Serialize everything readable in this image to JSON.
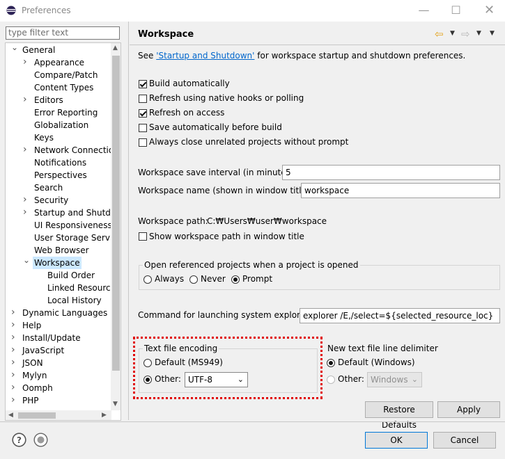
{
  "window": {
    "title": "Preferences",
    "minimize_icon": "minimize-icon",
    "maximize_icon": "maximize-icon",
    "close_icon": "close-icon"
  },
  "filter": {
    "placeholder": "type filter text"
  },
  "tree": [
    {
      "label": "General",
      "depth": 0,
      "arrow": "expanded"
    },
    {
      "label": "Appearance",
      "depth": 1,
      "arrow": "collapsed"
    },
    {
      "label": "Compare/Patch",
      "depth": 1,
      "arrow": "none"
    },
    {
      "label": "Content Types",
      "depth": 1,
      "arrow": "none"
    },
    {
      "label": "Editors",
      "depth": 1,
      "arrow": "collapsed"
    },
    {
      "label": "Error Reporting",
      "depth": 1,
      "arrow": "none"
    },
    {
      "label": "Globalization",
      "depth": 1,
      "arrow": "none"
    },
    {
      "label": "Keys",
      "depth": 1,
      "arrow": "none"
    },
    {
      "label": "Network Connection",
      "depth": 1,
      "arrow": "collapsed"
    },
    {
      "label": "Notifications",
      "depth": 1,
      "arrow": "none"
    },
    {
      "label": "Perspectives",
      "depth": 1,
      "arrow": "none"
    },
    {
      "label": "Search",
      "depth": 1,
      "arrow": "none"
    },
    {
      "label": "Security",
      "depth": 1,
      "arrow": "collapsed"
    },
    {
      "label": "Startup and Shutdown",
      "depth": 1,
      "arrow": "collapsed"
    },
    {
      "label": "UI Responsiveness M",
      "depth": 1,
      "arrow": "none"
    },
    {
      "label": "User Storage Service",
      "depth": 1,
      "arrow": "none"
    },
    {
      "label": "Web Browser",
      "depth": 1,
      "arrow": "none"
    },
    {
      "label": "Workspace",
      "depth": 1,
      "arrow": "expanded",
      "selected": true
    },
    {
      "label": "Build Order",
      "depth": 2,
      "arrow": "none"
    },
    {
      "label": "Linked Resources",
      "depth": 2,
      "arrow": "none"
    },
    {
      "label": "Local History",
      "depth": 2,
      "arrow": "none"
    },
    {
      "label": "Dynamic Languages",
      "depth": 0,
      "arrow": "collapsed"
    },
    {
      "label": "Help",
      "depth": 0,
      "arrow": "collapsed"
    },
    {
      "label": "Install/Update",
      "depth": 0,
      "arrow": "collapsed"
    },
    {
      "label": "JavaScript",
      "depth": 0,
      "arrow": "collapsed"
    },
    {
      "label": "JSON",
      "depth": 0,
      "arrow": "collapsed"
    },
    {
      "label": "Mylyn",
      "depth": 0,
      "arrow": "collapsed"
    },
    {
      "label": "Oomph",
      "depth": 0,
      "arrow": "collapsed"
    },
    {
      "label": "PHP",
      "depth": 0,
      "arrow": "collapsed"
    }
  ],
  "page": {
    "title": "Workspace",
    "see_prefix": "See ",
    "see_link": "'Startup and Shutdown'",
    "see_suffix": " for workspace startup and shutdown preferences."
  },
  "checkboxes": [
    {
      "label": "Build automatically",
      "checked": true
    },
    {
      "label": "Refresh using native hooks or polling",
      "checked": false
    },
    {
      "label": "Refresh on access",
      "checked": true
    },
    {
      "label": "Save automatically before build",
      "checked": false
    },
    {
      "label": "Always close unrelated projects without prompt",
      "checked": false
    }
  ],
  "save_interval": {
    "label": "Workspace save interval (in minutes):",
    "value": "5"
  },
  "workspace_name": {
    "label": "Workspace name (shown in window title):",
    "value": "workspace"
  },
  "workspace_path": {
    "label": "Workspace path:",
    "value": "C:₩Users₩user₩workspace"
  },
  "show_path": {
    "label": "Show workspace path in window title",
    "checked": false
  },
  "open_projects": {
    "legend": "Open referenced projects when a project is opened",
    "options": [
      "Always",
      "Never",
      "Prompt"
    ],
    "selected": "Prompt"
  },
  "explorer": {
    "label": "Command for launching system explorer:",
    "value": "explorer /E,/select=${selected_resource_loc}"
  },
  "encoding": {
    "legend": "Text file encoding",
    "default_label": "Default (MS949)",
    "other_label": "Other:",
    "selected": "other",
    "other_value": "UTF-8"
  },
  "delimiter": {
    "legend": "New text file line delimiter",
    "default_label": "Default (Windows)",
    "other_label": "Other:",
    "selected": "default",
    "other_value": "Windows"
  },
  "buttons": {
    "restore": "Restore Defaults",
    "apply": "Apply",
    "ok": "OK",
    "cancel": "Cancel"
  },
  "colors": {
    "link": "#0066cc",
    "selection": "#cce8ff",
    "highlight_border": "#e00000",
    "default_button_border": "#0078d7"
  }
}
